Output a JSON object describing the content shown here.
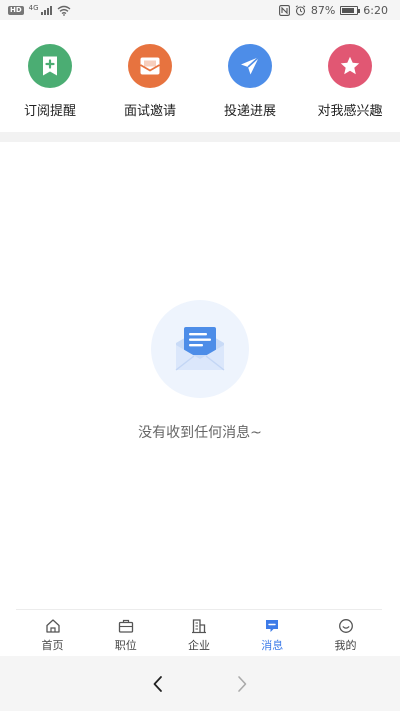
{
  "status_bar": {
    "network_type": "4G",
    "battery_percent": "87%",
    "time": "6:20",
    "icons": [
      "hd-icon",
      "signal-icon",
      "wifi-icon",
      "nfc-icon",
      "alarm-icon",
      "battery-icon"
    ]
  },
  "quick_actions": [
    {
      "label": "订阅提醒",
      "icon": "bookmark-plus-icon",
      "color": "#4bad73"
    },
    {
      "label": "面试邀请",
      "icon": "mail-open-icon",
      "color": "#e7733f"
    },
    {
      "label": "投递进展",
      "icon": "paper-plane-icon",
      "color": "#4d8de8"
    },
    {
      "label": "对我感兴趣",
      "icon": "star-icon",
      "color": "#e15773"
    }
  ],
  "empty_state": {
    "icon": "envelope-message-icon",
    "text": "没有收到任何消息~"
  },
  "tab_bar": {
    "active": "消息",
    "tabs": [
      {
        "label": "首页",
        "icon": "home-icon"
      },
      {
        "label": "职位",
        "icon": "briefcase-icon"
      },
      {
        "label": "企业",
        "icon": "building-icon"
      },
      {
        "label": "消息",
        "icon": "message-icon"
      },
      {
        "label": "我的",
        "icon": "profile-icon"
      }
    ]
  },
  "system_nav": {
    "back_icon": "chevron-left-icon",
    "forward_icon": "chevron-right-icon"
  },
  "colors": {
    "accent": "#3d7be8",
    "empty_circle_bg": "#eef4fd"
  }
}
